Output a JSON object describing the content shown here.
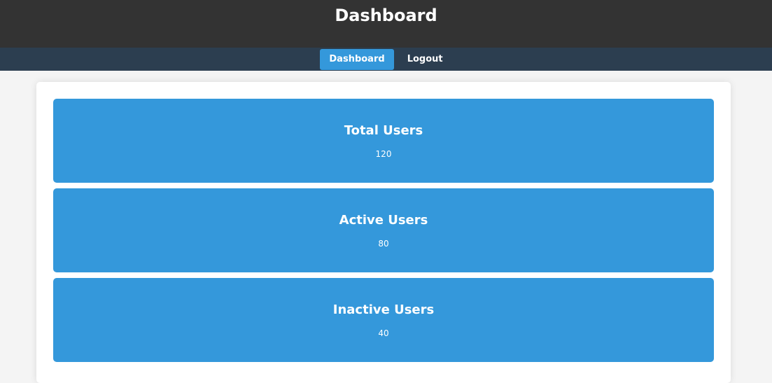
{
  "header": {
    "title": "Dashboard"
  },
  "nav": {
    "items": [
      {
        "label": "Dashboard",
        "active": true
      },
      {
        "label": "Logout",
        "active": false
      }
    ]
  },
  "cards": [
    {
      "title": "Total Users",
      "value": "120"
    },
    {
      "title": "Active Users",
      "value": "80"
    },
    {
      "title": "Inactive Users",
      "value": "40"
    }
  ],
  "colors": {
    "header_bg": "#333333",
    "nav_bg": "#2c3e50",
    "accent": "#3498db",
    "page_bg": "#f4f4f4"
  }
}
